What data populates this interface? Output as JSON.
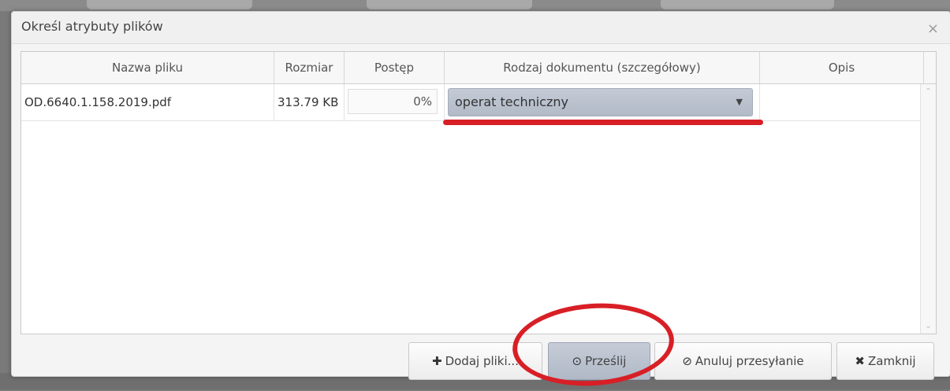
{
  "dialog": {
    "title": "Określ atrybuty plików",
    "close_glyph": "×"
  },
  "table": {
    "columns": [
      "Nazwa pliku",
      "Rozmiar",
      "Postęp",
      "Rodzaj dokumentu (szczegółowy)",
      "Opis"
    ],
    "rows": [
      {
        "name": "OD.6640.1.158.2019.pdf",
        "size": "313.79 KB",
        "progress": "0%",
        "doc_type": "operat techniczny",
        "description": ""
      }
    ]
  },
  "buttons": {
    "add_files": "Dodaj pliki...",
    "add_files_icon": "plus-icon",
    "send": "Prześlij",
    "send_icon": "circle-chevron-icon",
    "cancel_upload": "Anuluj przesyłanie",
    "cancel_icon": "circle-stop-icon",
    "close": "Zamknij",
    "close_icon": "x-icon"
  },
  "colors": {
    "annotation_red": "#d81f26",
    "primary_button": "#b8c0cd"
  }
}
